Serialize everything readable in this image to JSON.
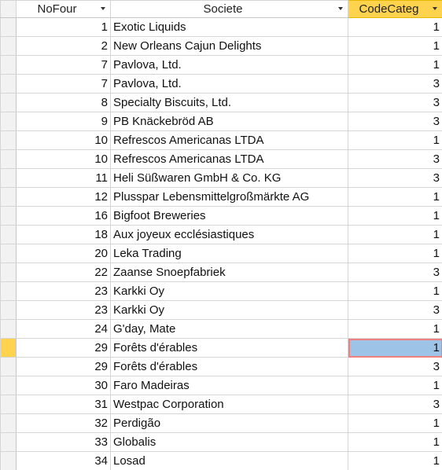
{
  "columns": [
    {
      "label": "NoFour"
    },
    {
      "label": "Societe"
    },
    {
      "label": "CodeCateg"
    }
  ],
  "rows": [
    {
      "nofour": "1",
      "societe": "Exotic Liquids",
      "codecateg": "1"
    },
    {
      "nofour": "2",
      "societe": "New Orleans Cajun Delights",
      "codecateg": "1"
    },
    {
      "nofour": "7",
      "societe": "Pavlova, Ltd.",
      "codecateg": "1"
    },
    {
      "nofour": "7",
      "societe": "Pavlova, Ltd.",
      "codecateg": "3"
    },
    {
      "nofour": "8",
      "societe": "Specialty Biscuits, Ltd.",
      "codecateg": "3"
    },
    {
      "nofour": "9",
      "societe": "PB Knäckebröd AB",
      "codecateg": "3"
    },
    {
      "nofour": "10",
      "societe": "Refrescos Americanas LTDA",
      "codecateg": "1"
    },
    {
      "nofour": "10",
      "societe": "Refrescos Americanas LTDA",
      "codecateg": "3"
    },
    {
      "nofour": "11",
      "societe": "Heli Süßwaren GmbH & Co. KG",
      "codecateg": "3"
    },
    {
      "nofour": "12",
      "societe": "Plusspar Lebensmittelgroßmärkte AG",
      "codecateg": "1"
    },
    {
      "nofour": "16",
      "societe": "Bigfoot Breweries",
      "codecateg": "1"
    },
    {
      "nofour": "18",
      "societe": "Aux joyeux ecclésiastiques",
      "codecateg": "1"
    },
    {
      "nofour": "20",
      "societe": "Leka Trading",
      "codecateg": "1"
    },
    {
      "nofour": "22",
      "societe": "Zaanse Snoepfabriek",
      "codecateg": "3"
    },
    {
      "nofour": "23",
      "societe": "Karkki Oy",
      "codecateg": "1"
    },
    {
      "nofour": "23",
      "societe": "Karkki Oy",
      "codecateg": "3"
    },
    {
      "nofour": "24",
      "societe": "G'day, Mate",
      "codecateg": "1"
    },
    {
      "nofour": "29",
      "societe": "Forêts d'érables",
      "codecateg": "1",
      "current": true
    },
    {
      "nofour": "29",
      "societe": "Forêts d'érables",
      "codecateg": "3"
    },
    {
      "nofour": "30",
      "societe": "Faro Madeiras",
      "codecateg": "1"
    },
    {
      "nofour": "31",
      "societe": "Westpac  Corporation",
      "codecateg": "3"
    },
    {
      "nofour": "32",
      "societe": "Perdigão",
      "codecateg": "1"
    },
    {
      "nofour": "33",
      "societe": "Globalis",
      "codecateg": "1"
    },
    {
      "nofour": "34",
      "societe": "Losad",
      "codecateg": "1"
    }
  ],
  "colors": {
    "active_header": "#ffd34d",
    "focused_cell": "#9dc3e6",
    "focused_border": "#f08080",
    "gridline": "#d5d5d5"
  },
  "icons": {
    "dropdown": "chevron-down-icon"
  }
}
